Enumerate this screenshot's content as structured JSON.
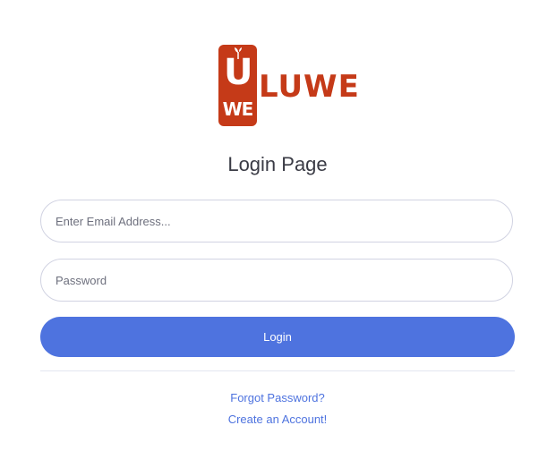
{
  "logo": {
    "badge_top": "U",
    "badge_bottom": "WE",
    "wordmark": "LUWE",
    "brand_color": "#c53a18"
  },
  "page": {
    "title": "Login Page"
  },
  "form": {
    "email_placeholder": "Enter Email Address...",
    "email_value": "",
    "password_placeholder": "Password",
    "password_value": "",
    "login_label": "Login",
    "button_color": "#4e73df"
  },
  "links": {
    "forgot_password": "Forgot Password?",
    "create_account": "Create an Account!"
  }
}
